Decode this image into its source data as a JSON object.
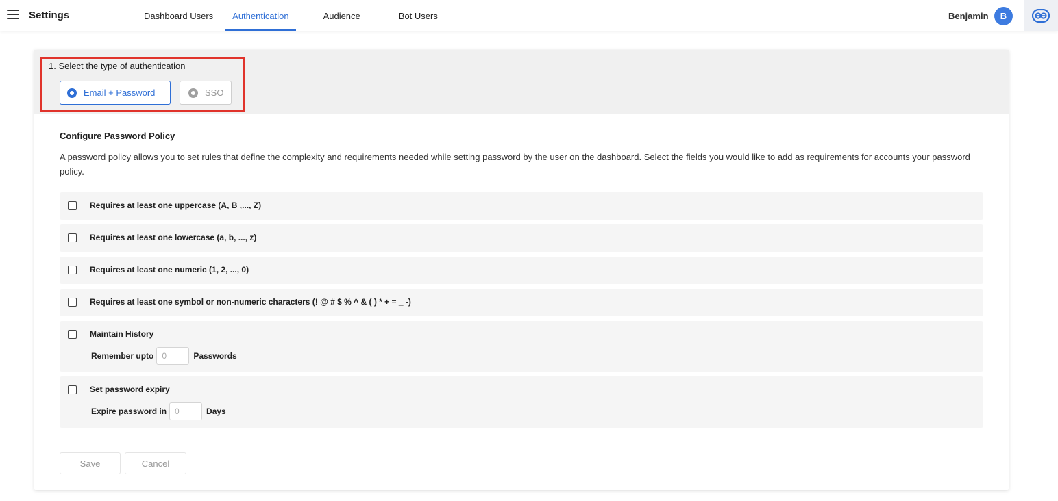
{
  "header": {
    "title": "Settings",
    "tabs": [
      {
        "label": "Dashboard Users",
        "active": false
      },
      {
        "label": "Authentication",
        "active": true
      },
      {
        "label": "Audience",
        "active": false
      },
      {
        "label": "Bot Users",
        "active": false
      }
    ],
    "user_name": "Benjamin",
    "avatar_initial": "B",
    "brand_icon": "bot-logo-icon"
  },
  "auth": {
    "heading": "1. Select the type of authentication",
    "options": [
      {
        "label": "Email + Password",
        "selected": true
      },
      {
        "label": "SSO",
        "selected": false
      }
    ]
  },
  "policy": {
    "title": "Configure Password Policy",
    "description": "A password policy allows you to set rules that define the complexity and requirements needed while setting password by the user on the dashboard. Select the fields you would like to add as requirements for accounts your password policy.",
    "rules": [
      {
        "label": "Requires at least one uppercase (A, B ,..., Z)",
        "checked": false
      },
      {
        "label": "Requires at least one lowercase (a, b, ..., z)",
        "checked": false
      },
      {
        "label": "Requires at least one numeric (1, 2, ..., 0)",
        "checked": false
      },
      {
        "label": "Requires at least one symbol or non-numeric characters (! @ # $ % ^ & ( ) * + = _ -)",
        "checked": false
      }
    ],
    "history": {
      "label": "Maintain History",
      "checked": false,
      "prefix": "Remember upto",
      "placeholder": "0",
      "suffix": "Passwords"
    },
    "expiry": {
      "label": "Set password expiry",
      "checked": false,
      "prefix": "Expire password in",
      "placeholder": "0",
      "suffix": "Days"
    }
  },
  "actions": {
    "save_label": "Save",
    "cancel_label": "Cancel"
  },
  "colors": {
    "accent": "#2f6fd6",
    "highlight": "#e0332b",
    "avatar": "#3d7be0"
  }
}
